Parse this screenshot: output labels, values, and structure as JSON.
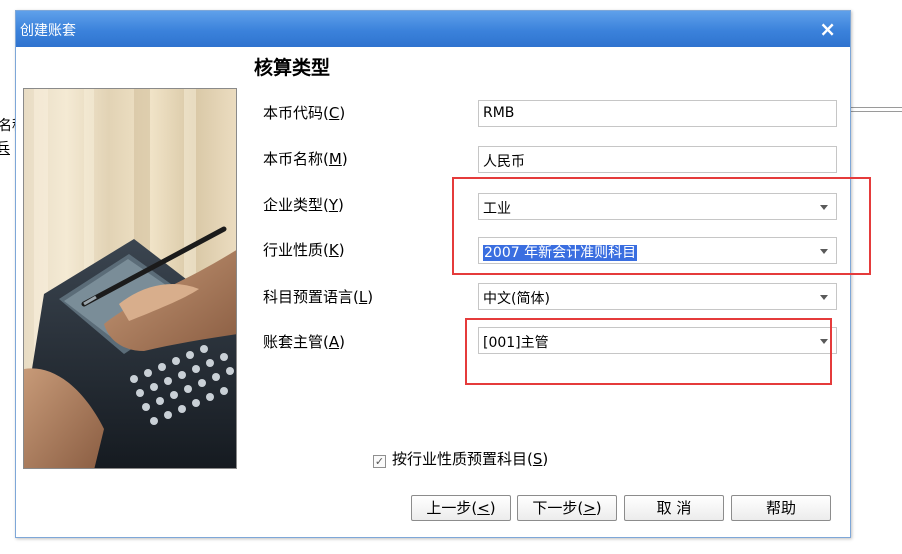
{
  "background": {
    "fragment_1": "名程",
    "fragment_2": "兵"
  },
  "dialog": {
    "title": "创建账套",
    "close_glyph": "×",
    "heading": "核算类型"
  },
  "form": {
    "currency_code": {
      "label": "本币代码(",
      "hotkey": "C",
      "value": "RMB"
    },
    "currency_name": {
      "label": "本币名称(",
      "hotkey": "M",
      "value": "人民币"
    },
    "enterprise_type": {
      "label": "企业类型(",
      "hotkey": "Y",
      "value": "工业"
    },
    "industry_nature": {
      "label": "行业性质(",
      "hotkey": "K",
      "value": "2007 年新会计准则科目"
    },
    "account_language": {
      "label": "科目预置语言(",
      "hotkey": "L",
      "value": "中文(简体)"
    },
    "supervisor": {
      "label": "账套主管(",
      "hotkey": "A",
      "value": "[001]主管"
    },
    "close_paren": ")"
  },
  "preset": {
    "label": "按行业性质预置科目(",
    "hotkey": "S",
    "checked": true,
    "check_glyph": "✓"
  },
  "buttons": {
    "prev": {
      "text": "上一步(",
      "hotkey": "<",
      "tail": ")"
    },
    "next": {
      "text": "下一步(",
      "hotkey": ">",
      "tail": ")"
    },
    "cancel": "取 消",
    "help": "帮助"
  },
  "colors": {
    "titlebar": "#3b82db",
    "highlight_box": "#e53b3b",
    "selection": "#3a6ee0"
  }
}
